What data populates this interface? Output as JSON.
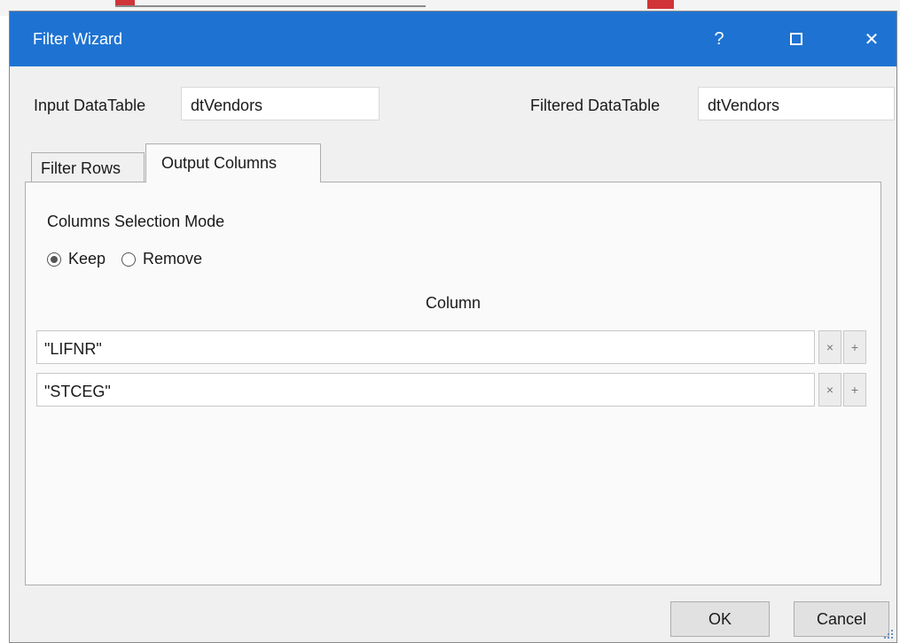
{
  "window": {
    "title": "Filter Wizard",
    "help_glyph": "?",
    "close_glyph": "✕"
  },
  "input_datatable": {
    "label": "Input DataTable",
    "value": "dtVendors"
  },
  "filtered_datatable": {
    "label": "Filtered DataTable",
    "value": "dtVendors"
  },
  "tabs": [
    {
      "label": "Filter Rows",
      "active": false
    },
    {
      "label": "Output Columns",
      "active": true
    }
  ],
  "output_columns": {
    "mode_label": "Columns Selection Mode",
    "options": [
      {
        "label": "Keep",
        "selected": true
      },
      {
        "label": "Remove",
        "selected": false
      }
    ],
    "column_header": "Column",
    "rows": [
      {
        "value": "\"LIFNR\""
      },
      {
        "value": "\"STCEG\""
      }
    ],
    "remove_glyph": "×",
    "add_glyph": "+"
  },
  "footer": {
    "ok_label": "OK",
    "cancel_label": "Cancel"
  },
  "colors": {
    "titlebar": "#1e73d2",
    "dialog_bg": "#f0f0f0",
    "panel_bg": "#fafafa"
  },
  "icons": [
    "help-icon",
    "maximize-icon",
    "close-icon",
    "remove-row-icon",
    "add-row-icon",
    "radio-checked-icon",
    "radio-unchecked-icon",
    "resize-grip-icon"
  ]
}
